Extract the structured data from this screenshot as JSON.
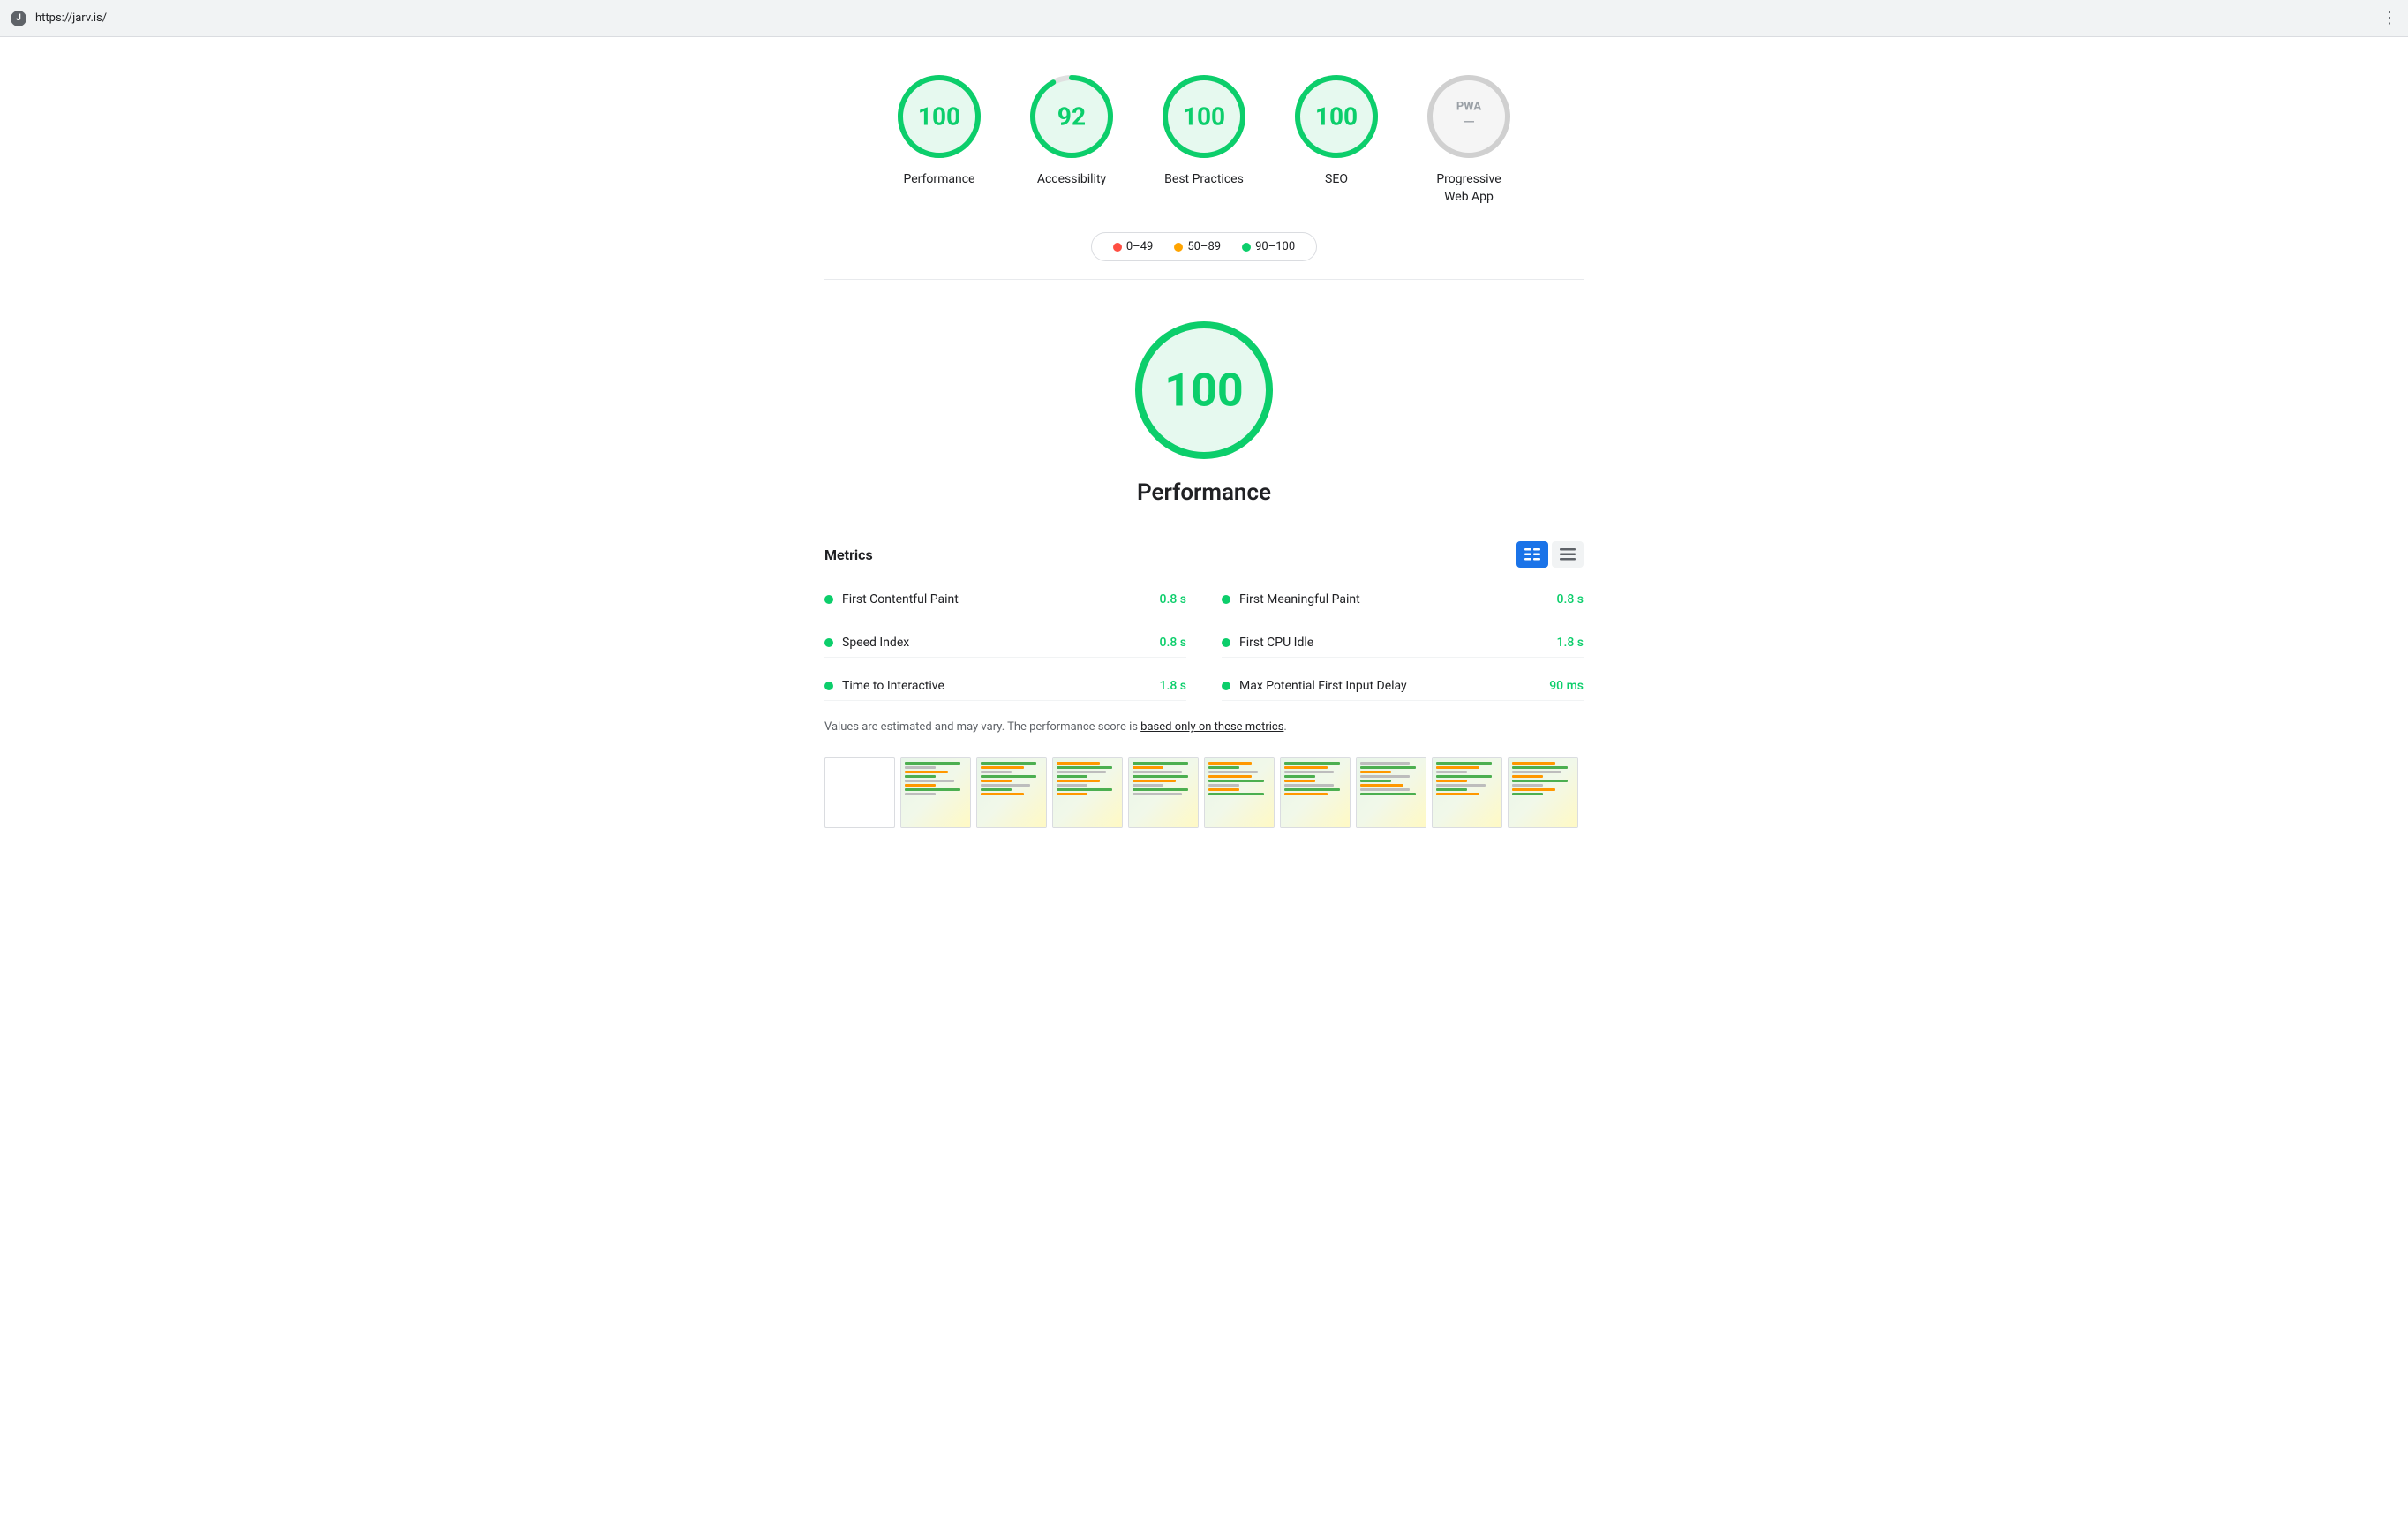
{
  "browser": {
    "url": "https://jarv.is/",
    "favicon_letter": "J",
    "menu_icon": "⋮"
  },
  "scores": [
    {
      "id": "performance",
      "value": "100",
      "label": "Performance",
      "color": "#0cce6b",
      "pwa": false,
      "percent": 100
    },
    {
      "id": "accessibility",
      "value": "92",
      "label": "Accessibility",
      "color": "#0cce6b",
      "pwa": false,
      "percent": 92
    },
    {
      "id": "best-practices",
      "value": "100",
      "label": "Best Practices",
      "color": "#0cce6b",
      "pwa": false,
      "percent": 100
    },
    {
      "id": "seo",
      "value": "100",
      "label": "SEO",
      "color": "#0cce6b",
      "pwa": false,
      "percent": 100
    },
    {
      "id": "pwa",
      "value": "—",
      "label": "Progressive\nWeb App",
      "color": "#9aa0a6",
      "pwa": true,
      "percent": 0
    }
  ],
  "legend": {
    "items": [
      {
        "id": "fail",
        "color": "#ff4e42",
        "range": "0–49"
      },
      {
        "id": "average",
        "color": "#ffa400",
        "range": "50–89"
      },
      {
        "id": "pass",
        "color": "#0cce6b",
        "range": "90–100"
      }
    ]
  },
  "big_score": {
    "value": "100",
    "label": "Performance",
    "color": "#0cce6b",
    "percent": 100
  },
  "metrics": {
    "title": "Metrics",
    "toggle": {
      "list_icon": "☰",
      "grid_icon": "⊟"
    },
    "items": [
      {
        "name": "First Contentful Paint",
        "value": "0.8 s",
        "color": "#0cce6b"
      },
      {
        "name": "First Meaningful Paint",
        "value": "0.8 s",
        "color": "#0cce6b"
      },
      {
        "name": "Speed Index",
        "value": "0.8 s",
        "color": "#0cce6b"
      },
      {
        "name": "First CPU Idle",
        "value": "1.8 s",
        "color": "#0cce6b"
      },
      {
        "name": "Time to Interactive",
        "value": "1.8 s",
        "color": "#0cce6b"
      },
      {
        "name": "Max Potential First Input Delay",
        "value": "90 ms",
        "color": "#0cce6b"
      }
    ],
    "note_prefix": "Values are estimated and may vary. The performance score is ",
    "note_link": "based only on these metrics",
    "note_suffix": "."
  }
}
